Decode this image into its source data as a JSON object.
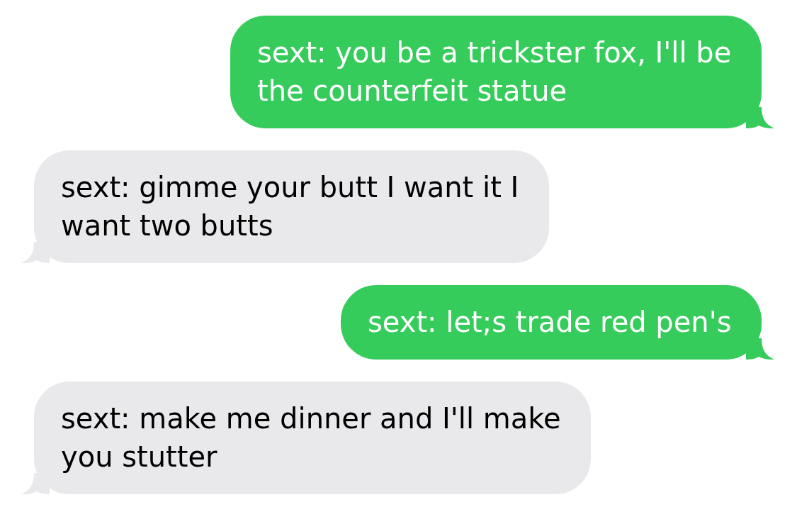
{
  "messages": [
    {
      "kind": "sent",
      "text": "sext: you be a trickster fox, I'll be the counterfeit statue"
    },
    {
      "kind": "received",
      "text": "sext: gimme your butt I want it I want two butts"
    },
    {
      "kind": "sent",
      "text": "sext: let;s trade red pen's"
    },
    {
      "kind": "received",
      "text": "sext: make me dinner and I'll make you stutter"
    }
  ]
}
